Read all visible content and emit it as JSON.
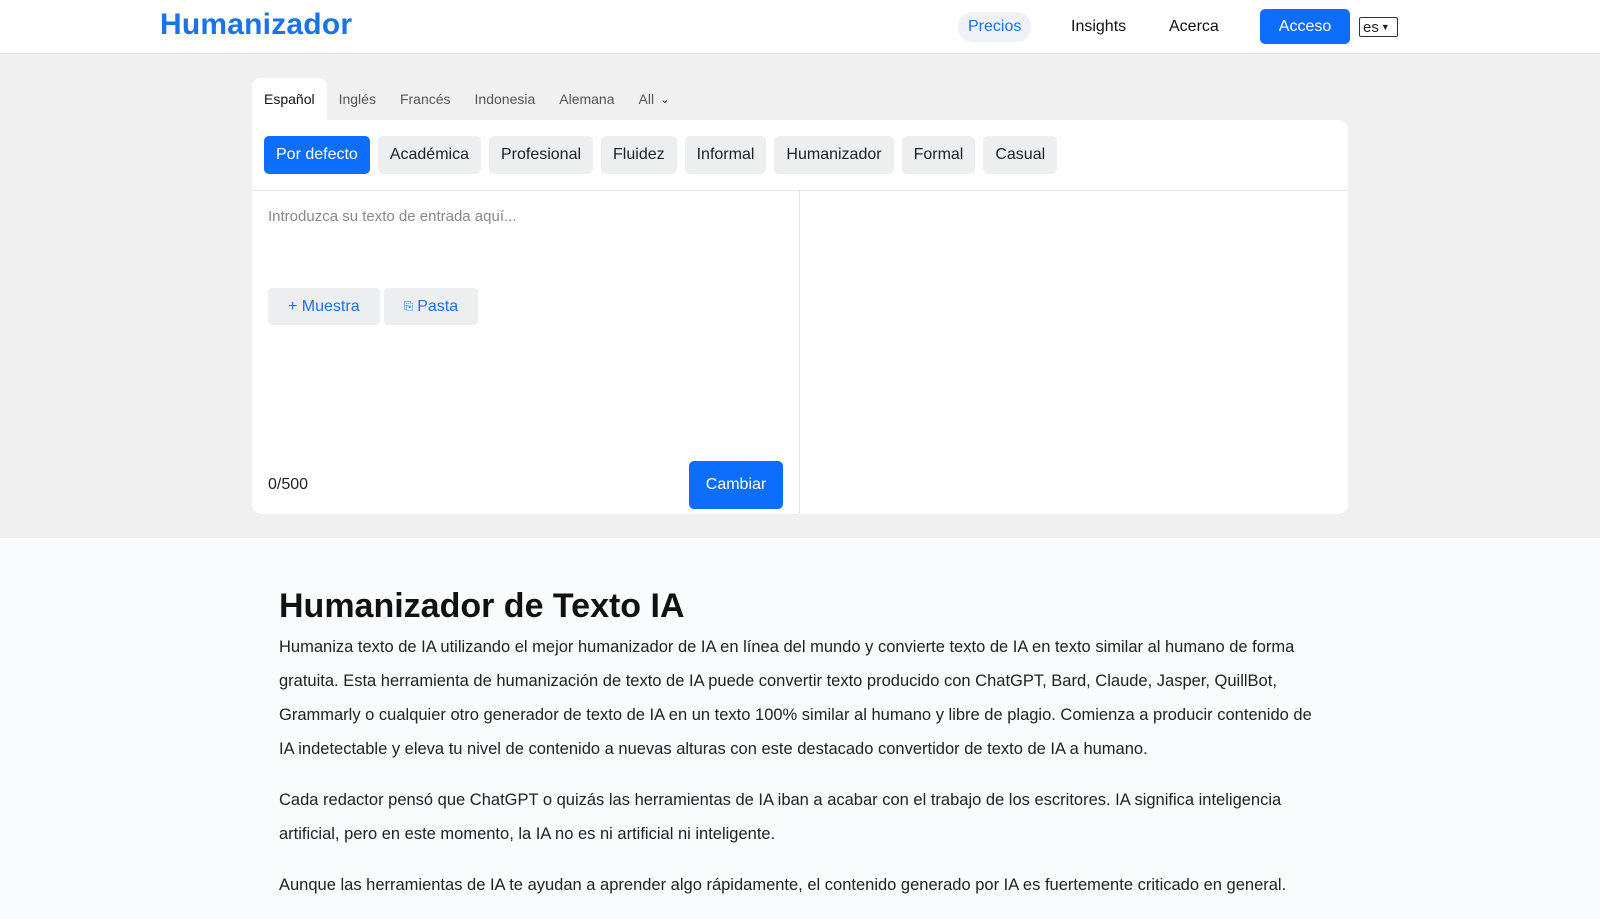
{
  "header": {
    "logo": "Humanizador",
    "nav": {
      "precios": "Precios",
      "insights": "Insights",
      "acerca": "Acerca"
    },
    "login": "Acceso",
    "language": "es"
  },
  "languages": [
    "Español",
    "Inglés",
    "Francés",
    "Indonesia",
    "Alemana",
    "All"
  ],
  "modes": [
    "Por defecto",
    "Académica",
    "Profesional",
    "Fluidez",
    "Informal",
    "Humanizador",
    "Formal",
    "Casual"
  ],
  "editor": {
    "placeholder": "Introduzca su texto de entrada aquí...",
    "sample_label": "+ Muestra",
    "paste_icon": "⎘",
    "paste_label": "Pasta",
    "counter": "0/500",
    "submit": "Cambiar"
  },
  "article": {
    "title": "Humanizador de Texto IA",
    "paragraphs": [
      "Humaniza texto de IA utilizando el mejor humanizador de IA en línea del mundo y convierte texto de IA en texto similar al humano de forma gratuita. Esta herramienta de humanización de texto de IA puede convertir texto producido con ChatGPT, Bard, Claude, Jasper, QuillBot, Grammarly o cualquier otro generador de texto de IA en un texto 100% similar al humano y libre de plagio. Comienza a producir contenido de IA indetectable y eleva tu nivel de contenido a nuevas alturas con este destacado convertidor de texto de IA a humano.",
      "Cada redactor pensó que ChatGPT o quizás las herramientas de IA iban a acabar con el trabajo de los escritores. IA significa inteligencia artificial, pero en este momento, la IA no es ni artificial ni inteligente.",
      "Aunque las herramientas de IA te ayudan a aprender algo rápidamente, el contenido generado por IA es fuertemente criticado en general."
    ]
  },
  "colors": {
    "accent": "#0d6efd",
    "logo": "#1a73e8",
    "band": "#f0f0f0"
  }
}
